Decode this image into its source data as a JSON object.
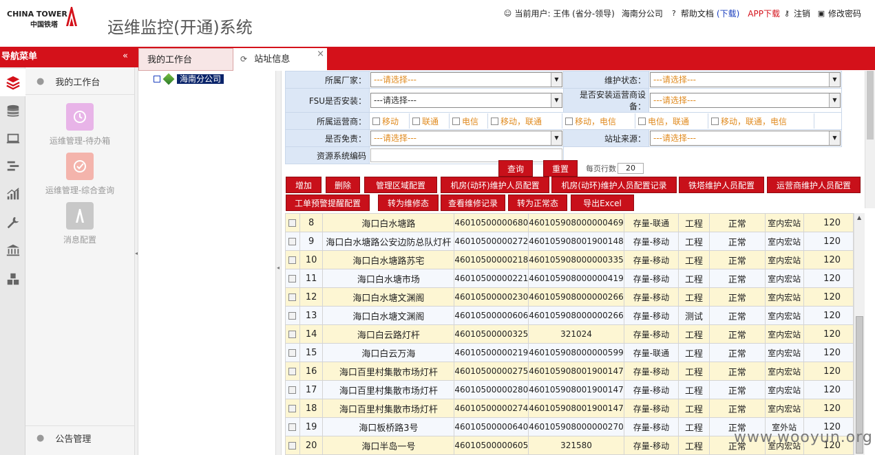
{
  "header": {
    "logo_en": "CHINA TOWER",
    "logo_cn": "中国铁塔",
    "app_title": "运维监控(开通)系统",
    "current_user_label": "当前用户: 王伟 (省分-领导)",
    "company": "海南分公司",
    "help_doc": "帮助文档",
    "download": "(下载)",
    "app_download": "APP下载",
    "logout": "注销",
    "change_password": "修改密码"
  },
  "nav": {
    "title": "导航菜单",
    "collapse": "«",
    "tabs": [
      {
        "label": "我的工作台"
      },
      {
        "label": "站址信息",
        "close": "×"
      }
    ],
    "menu_head": "我的工作台",
    "menu_foot": "公告管理",
    "tiles": [
      {
        "label": "运维管理-待办箱",
        "color": "#e8b4e8"
      },
      {
        "label": "运维管理-综合查询",
        "color": "#f4b4ac"
      },
      {
        "label": "消息配置",
        "color": "#c8c8c8"
      }
    ],
    "side_icons": [
      "layers-icon",
      "database-icon",
      "laptop-icon",
      "list-icon",
      "chart-icon",
      "wrench-icon",
      "bank-icon",
      "blocks-icon"
    ]
  },
  "tree": {
    "root": "海南分公司"
  },
  "form": {
    "vendor_label": "所属厂家：",
    "vendor_value": "---请选择---",
    "maint_status_label": "维护状态：",
    "maint_status_value": "---请选择---",
    "fsu_label": "FSU是否安装：",
    "fsu_value": "---请选择---",
    "operator_device_label": "是否安装运营商设备：",
    "operator_device_value": "---请选择---",
    "operator_label": "所属运营商：",
    "operators": [
      "移动",
      "联通",
      "电信",
      "移动，联通",
      "移动，电信",
      "电信，联通",
      "移动，联通，电信"
    ],
    "free_label": "是否免责：",
    "free_value": "---请选择---",
    "source_label": "站址来源：",
    "source_value": "---请选择---",
    "res_code_label": "资源系统编码"
  },
  "actions": {
    "query": "查询",
    "reset": "重置",
    "per_page_label": "每页行数",
    "per_page_value": "20",
    "row1": [
      "增加",
      "删除",
      "管理区域配置",
      "机房(动环)维护人员配置",
      "机房(动环)维护人员配置记录",
      "铁塔维护人员配置",
      "运营商维护人员配置"
    ],
    "row2": [
      "工单预警提醒配置",
      "转为维修态",
      "查看维修记录",
      "转为正常态",
      "导出Excel"
    ]
  },
  "table": {
    "rows": [
      {
        "no": "8",
        "name": "海口白水塘路",
        "code": "46010500000680",
        "code2": "460105908000000469",
        "type": "存量-联通",
        "phase": "工程",
        "status": "正常",
        "room": "室内宏站",
        "num": "120"
      },
      {
        "no": "9",
        "name": "海口白水塘路公安边防总队灯杆",
        "code": "46010500000272",
        "code2": "460105908001900148",
        "type": "存量-移动",
        "phase": "工程",
        "status": "正常",
        "room": "室内宏站",
        "num": "120"
      },
      {
        "no": "10",
        "name": "海口白水塘路苏宅",
        "code": "46010500000218",
        "code2": "460105908000000335",
        "type": "存量-移动",
        "phase": "工程",
        "status": "正常",
        "room": "室内宏站",
        "num": "120"
      },
      {
        "no": "11",
        "name": "海口白水塘市场",
        "code": "46010500000221",
        "code2": "460105908000000419",
        "type": "存量-移动",
        "phase": "工程",
        "status": "正常",
        "room": "室内宏站",
        "num": "120"
      },
      {
        "no": "12",
        "name": "海口白水塘文渊阁",
        "code": "46010500000230",
        "code2": "460105908000000266",
        "type": "存量-移动",
        "phase": "工程",
        "status": "正常",
        "room": "室内宏站",
        "num": "120"
      },
      {
        "no": "13",
        "name": "海口白水塘文渊阁",
        "code": "46010500000606",
        "code2": "460105908000000266",
        "type": "存量-移动",
        "phase": "测试",
        "status": "正常",
        "room": "室内宏站",
        "num": "120"
      },
      {
        "no": "14",
        "name": "海口白云路灯杆",
        "code": "46010500000325",
        "code2": "321024",
        "type": "存量-移动",
        "phase": "工程",
        "status": "正常",
        "room": "室内宏站",
        "num": "120"
      },
      {
        "no": "15",
        "name": "海口白云万海",
        "code": "46010500000219",
        "code2": "460105908000000599",
        "type": "存量-联通",
        "phase": "工程",
        "status": "正常",
        "room": "室内宏站",
        "num": "120"
      },
      {
        "no": "16",
        "name": "海口百里村集散市场灯杆",
        "code": "46010500000275",
        "code2": "460105908001900147",
        "type": "存量-移动",
        "phase": "工程",
        "status": "正常",
        "room": "室内宏站",
        "num": "120"
      },
      {
        "no": "17",
        "name": "海口百里村集散市场灯杆",
        "code": "46010500000280",
        "code2": "460105908001900147",
        "type": "存量-移动",
        "phase": "工程",
        "status": "正常",
        "room": "室内宏站",
        "num": "120"
      },
      {
        "no": "18",
        "name": "海口百里村集散市场灯杆",
        "code": "46010500000274",
        "code2": "460105908001900147",
        "type": "存量-移动",
        "phase": "工程",
        "status": "正常",
        "room": "室内宏站",
        "num": "120"
      },
      {
        "no": "19",
        "name": "海口板桥路3号",
        "code": "46010500000640",
        "code2": "460105908000000270",
        "type": "存量-移动",
        "phase": "工程",
        "status": "正常",
        "room": "室外站",
        "num": "120"
      },
      {
        "no": "20",
        "name": "海口半岛一号",
        "code": "46010500000605",
        "code2": "321580",
        "type": "存量-移动",
        "phase": "工程",
        "status": "正常",
        "room": "室内宏站",
        "num": "120"
      }
    ]
  },
  "watermark": "www.wooyun.org",
  "colors": {
    "brand_red": "#d4111a",
    "row_odd": "#fdf6d3",
    "row_even": "#f5f8fd",
    "label_bg": "#dce7f6"
  }
}
